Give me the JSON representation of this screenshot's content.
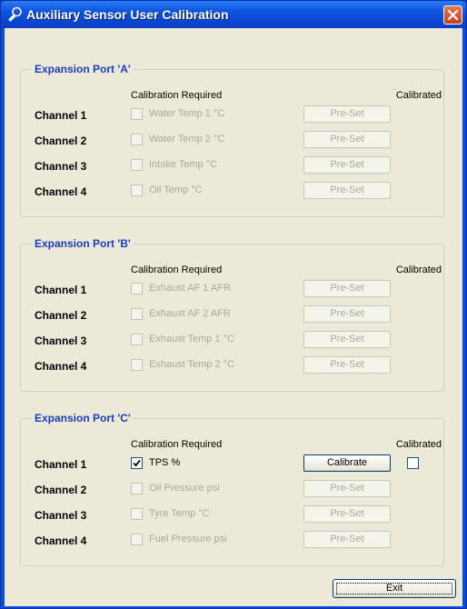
{
  "window": {
    "title": "Auxiliary Sensor User Calibration",
    "icon": "wrench-icon",
    "accent_color": "#0a4ed8",
    "close_color": "#d8532e"
  },
  "headers": {
    "calibration_required": "Calibration Required",
    "calibrated": "Calibrated"
  },
  "ports": [
    {
      "title": "Expansion Port 'A'",
      "channels": [
        {
          "label": "Channel 1",
          "sensor": "Water Temp 1 °C",
          "checked": false,
          "button": "Pre-Set",
          "enabled": false
        },
        {
          "label": "Channel 2",
          "sensor": "Water Temp 2 °C",
          "checked": false,
          "button": "Pre-Set",
          "enabled": false
        },
        {
          "label": "Channel 3",
          "sensor": "Intake Temp °C",
          "checked": false,
          "button": "Pre-Set",
          "enabled": false
        },
        {
          "label": "Channel 4",
          "sensor": "Oil Temp °C",
          "checked": false,
          "button": "Pre-Set",
          "enabled": false
        }
      ]
    },
    {
      "title": "Expansion Port 'B'",
      "channels": [
        {
          "label": "Channel 1",
          "sensor": "Exhaust AF 1 AFR",
          "checked": false,
          "button": "Pre-Set",
          "enabled": false
        },
        {
          "label": "Channel 2",
          "sensor": "Exhaust AF 2 AFR",
          "checked": false,
          "button": "Pre-Set",
          "enabled": false
        },
        {
          "label": "Channel 3",
          "sensor": "Exhaust Temp 1 °C",
          "checked": false,
          "button": "Pre-Set",
          "enabled": false
        },
        {
          "label": "Channel 4",
          "sensor": "Exhaust Temp 2 °C",
          "checked": false,
          "button": "Pre-Set",
          "enabled": false
        }
      ]
    },
    {
      "title": "Expansion Port 'C'",
      "channels": [
        {
          "label": "Channel 1",
          "sensor": "TPS %",
          "checked": true,
          "button": "Calibrate",
          "enabled": true,
          "calibrated": false
        },
        {
          "label": "Channel 2",
          "sensor": "Oil Pressure psi",
          "checked": false,
          "button": "Pre-Set",
          "enabled": false
        },
        {
          "label": "Channel 3",
          "sensor": "Tyre Temp °C",
          "checked": false,
          "button": "Pre-Set",
          "enabled": false
        },
        {
          "label": "Channel 4",
          "sensor": "Fuel Pressure psi",
          "checked": false,
          "button": "Pre-Set",
          "enabled": false
        }
      ]
    }
  ],
  "exit_label": "Exit"
}
